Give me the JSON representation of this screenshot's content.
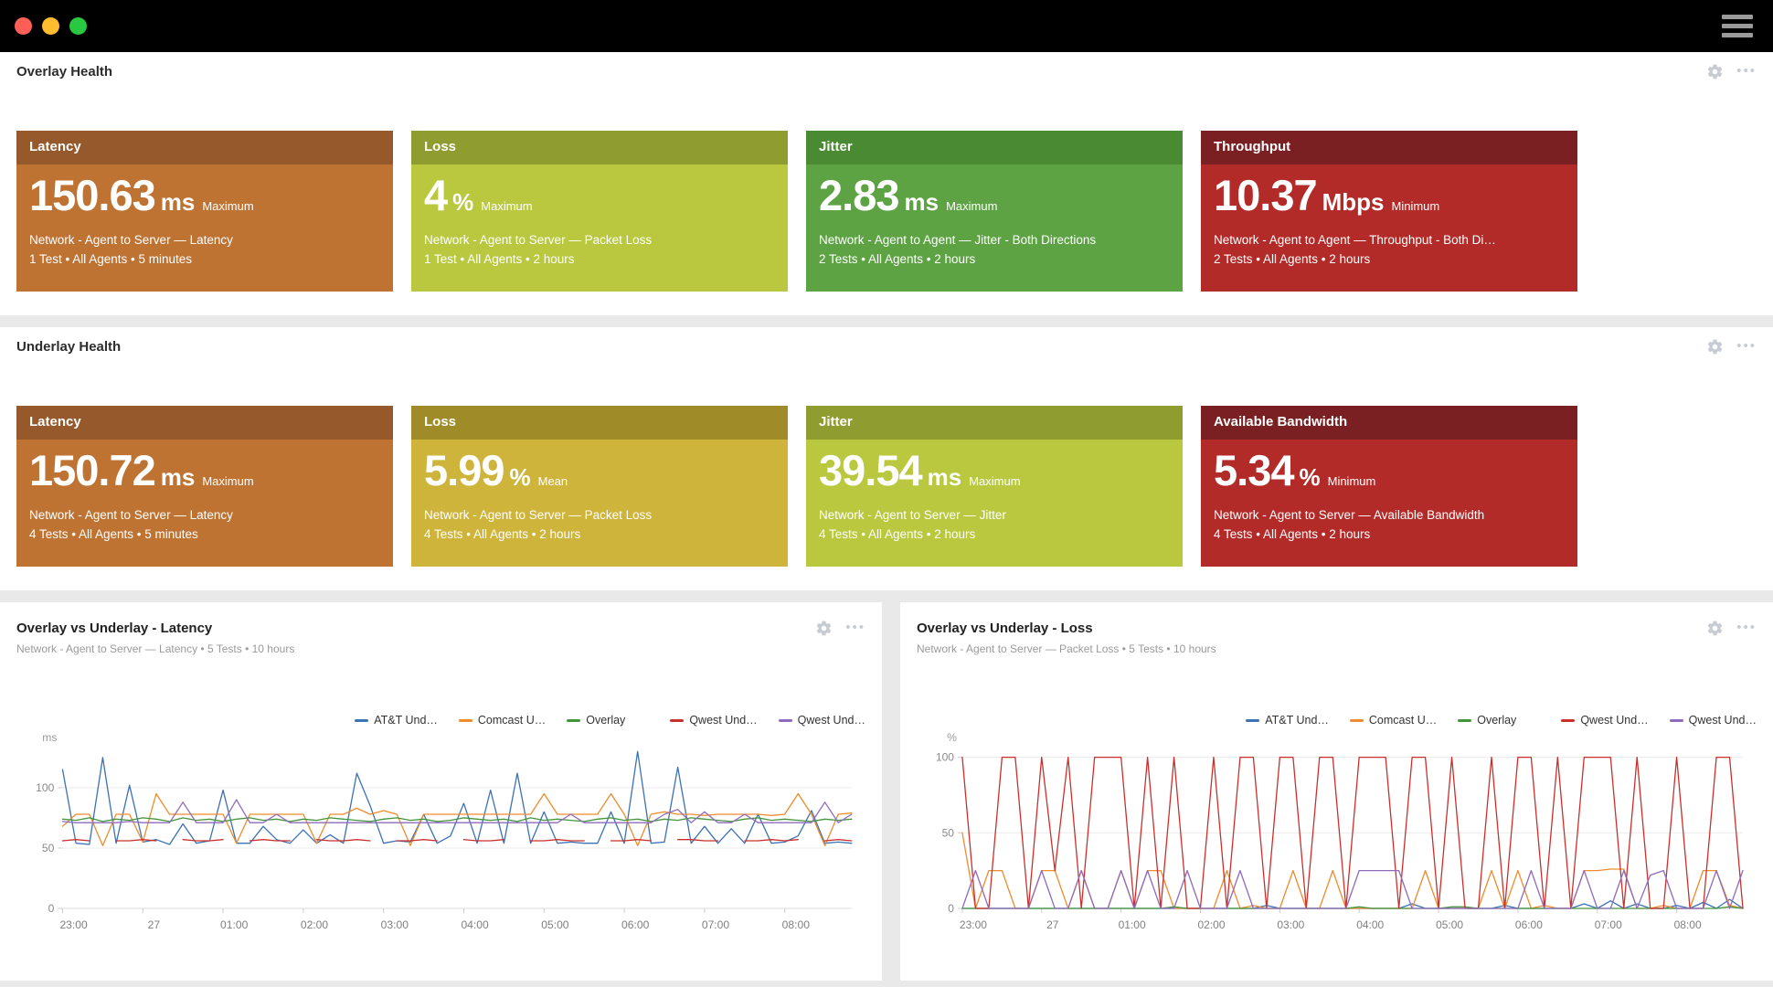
{
  "window": {
    "traffic_lights": [
      "#ff5f57",
      "#febc2e",
      "#28c840"
    ]
  },
  "sections": {
    "overlay": {
      "title": "Overlay Health",
      "cards": [
        {
          "label": "Latency",
          "value": "150.63",
          "unit": "ms",
          "qualifier": "Maximum",
          "line1": "Network - Agent to Server — Latency",
          "line2": "1 Test • All Agents • 5 minutes",
          "header_color": "#96592b",
          "body_color": "#bf7333"
        },
        {
          "label": "Loss",
          "value": "4",
          "unit": "%",
          "qualifier": "Maximum",
          "line1": "Network - Agent to Server — Packet Loss",
          "line2": "1 Test • All Agents • 2 hours",
          "header_color": "#8f9c2f",
          "body_color": "#b9c83f"
        },
        {
          "label": "Jitter",
          "value": "2.83",
          "unit": "ms",
          "qualifier": "Maximum",
          "line1": "Network - Agent to Agent — Jitter - Both Directions",
          "line2": "2 Tests • All Agents • 2 hours",
          "header_color": "#4a8a33",
          "body_color": "#5da344"
        },
        {
          "label": "Throughput",
          "value": "10.37",
          "unit": "Mbps",
          "qualifier": "Minimum",
          "line1": "Network - Agent to Agent — Throughput - Both Di…",
          "line2": "2 Tests • All Agents • 2 hours",
          "header_color": "#7a2023",
          "body_color": "#b32b28"
        }
      ]
    },
    "underlay": {
      "title": "Underlay Health",
      "cards": [
        {
          "label": "Latency",
          "value": "150.72",
          "unit": "ms",
          "qualifier": "Maximum",
          "line1": "Network - Agent to Server — Latency",
          "line2": "4 Tests • All Agents • 5 minutes",
          "header_color": "#96592b",
          "body_color": "#bf7333"
        },
        {
          "label": "Loss",
          "value": "5.99",
          "unit": "%",
          "qualifier": "Mean",
          "line1": "Network - Agent to Server — Packet Loss",
          "line2": "4 Tests • All Agents • 2 hours",
          "header_color": "#9f8c28",
          "body_color": "#cfb43c"
        },
        {
          "label": "Jitter",
          "value": "39.54",
          "unit": "ms",
          "qualifier": "Maximum",
          "line1": "Network - Agent to Server — Jitter",
          "line2": "4 Tests • All Agents • 2 hours",
          "header_color": "#8f9c2f",
          "body_color": "#b9c83f"
        },
        {
          "label": "Available Bandwidth",
          "value": "5.34",
          "unit": "%",
          "qualifier": "Minimum",
          "line1": "Network - Agent to Server — Available Bandwidth",
          "line2": "4 Tests • All Agents • 2 hours",
          "header_color": "#7a2023",
          "body_color": "#b32b28"
        }
      ]
    }
  },
  "chart_data": [
    {
      "type": "line",
      "title": "Overlay vs Underlay - Latency",
      "subtitle": "Network - Agent to Server — Latency • 5 Tests • 10 hours",
      "ylabel": "ms",
      "ylim": [
        0,
        134
      ],
      "yticks": [
        0,
        50,
        100
      ],
      "grid": true,
      "legend_position": "top-right",
      "x_start_label": "23:00",
      "x_interval_minutes": 10,
      "x_total_minutes": 590,
      "x_tick_labels": [
        "23:00",
        "27",
        "01:00",
        "02:00",
        "03:00",
        "04:00",
        "05:00",
        "06:00",
        "07:00",
        "08:00"
      ],
      "series": [
        {
          "name": "AT&T Und…",
          "color": "#3d72b4",
          "values": [
            115,
            54,
            53,
            125,
            54,
            102,
            55,
            57,
            53,
            70,
            54,
            56,
            98,
            54,
            54,
            68,
            57,
            54,
            65,
            54,
            61,
            54,
            112,
            85,
            54,
            56,
            55,
            78,
            54,
            60,
            87,
            54,
            98,
            54,
            112,
            54,
            80,
            54,
            55,
            54,
            54,
            80,
            54,
            130,
            54,
            55,
            117,
            54,
            68,
            54,
            66,
            54,
            78,
            54,
            55,
            60,
            81,
            54,
            55,
            54
          ]
        },
        {
          "name": "Comcast U…",
          "color": "#ef8c2d",
          "values": [
            68,
            78,
            78,
            52,
            78,
            78,
            55,
            95,
            78,
            78,
            78,
            78,
            78,
            54,
            78,
            78,
            78,
            78,
            78,
            54,
            78,
            78,
            83,
            78,
            81,
            78,
            52,
            78,
            78,
            78,
            78,
            78,
            78,
            78,
            78,
            78,
            95,
            78,
            78,
            78,
            78,
            95,
            78,
            52,
            78,
            80,
            78,
            78,
            77,
            78,
            78,
            78,
            78,
            77,
            78,
            95,
            78,
            52,
            78,
            79
          ]
        },
        {
          "name": "Overlay",
          "color": "#43953b",
          "values": [
            74,
            73,
            75,
            72,
            74,
            73,
            75,
            74,
            72,
            75,
            73,
            74,
            72,
            74,
            75,
            73,
            74,
            72,
            74,
            73,
            75,
            74,
            73,
            72,
            74,
            75,
            73,
            74,
            72,
            73,
            75,
            74,
            73,
            74,
            72,
            75,
            73,
            74,
            73,
            72,
            74,
            75,
            73,
            74,
            72,
            74,
            73,
            75,
            74,
            73,
            72,
            74,
            75,
            73,
            74,
            73,
            72,
            74,
            73,
            74
          ]
        },
        {
          "name": "Qwest Und…",
          "color": "#c9302c",
          "values": [
            56,
            57,
            56,
            null,
            56,
            56,
            57,
            56,
            null,
            57,
            56,
            56,
            57,
            null,
            56,
            57,
            56,
            56,
            null,
            57,
            56,
            56,
            57,
            56,
            null,
            56,
            56,
            57,
            56,
            null,
            57,
            56,
            56,
            57,
            null,
            56,
            56,
            57,
            56,
            56,
            null,
            56,
            56,
            57,
            56,
            null,
            57,
            57,
            56,
            56,
            null,
            56,
            56,
            57,
            56,
            57,
            null,
            56,
            57,
            56
          ]
        },
        {
          "name": "Qwest Und…",
          "color": "#8f6bbf",
          "values": [
            72,
            71,
            71,
            71,
            71,
            72,
            71,
            71,
            71,
            88,
            71,
            71,
            71,
            90,
            71,
            71,
            78,
            71,
            71,
            71,
            71,
            71,
            71,
            71,
            71,
            71,
            71,
            71,
            71,
            71,
            71,
            71,
            71,
            71,
            71,
            71,
            71,
            71,
            78,
            71,
            71,
            71,
            71,
            71,
            71,
            78,
            82,
            71,
            80,
            71,
            71,
            78,
            71,
            71,
            71,
            71,
            71,
            88,
            71,
            78
          ]
        }
      ]
    },
    {
      "type": "line",
      "title": "Overlay vs Underlay - Loss",
      "subtitle": "Network - Agent to Server — Packet Loss • 5 Tests • 10 hours",
      "ylabel": "%",
      "ylim": [
        0,
        107
      ],
      "yticks": [
        0,
        50,
        100
      ],
      "grid": true,
      "legend_position": "top-right",
      "x_start_label": "23:00",
      "x_interval_minutes": 10,
      "x_total_minutes": 590,
      "x_tick_labels": [
        "23:00",
        "27",
        "01:00",
        "02:00",
        "03:00",
        "04:00",
        "05:00",
        "06:00",
        "07:00",
        "08:00"
      ],
      "series": [
        {
          "name": "AT&T Und…",
          "color": "#3d72b4",
          "values": [
            0,
            0,
            0,
            0,
            0,
            0,
            0,
            0,
            0,
            0,
            0,
            0,
            0,
            0,
            0,
            0,
            0,
            0,
            0,
            0,
            0,
            0,
            0,
            2,
            0,
            0,
            0,
            0,
            0,
            0,
            0,
            0,
            0,
            0,
            3,
            0,
            0,
            0,
            0,
            0,
            0,
            2,
            0,
            0,
            0,
            0,
            0,
            3,
            0,
            5,
            0,
            3,
            0,
            0,
            2,
            0,
            4,
            0,
            6,
            0
          ]
        },
        {
          "name": "Comcast U…",
          "color": "#ef8c2d",
          "values": [
            50,
            0,
            25,
            25,
            0,
            0,
            25,
            25,
            0,
            25,
            0,
            0,
            25,
            0,
            25,
            25,
            0,
            0,
            0,
            0,
            25,
            0,
            2,
            0,
            0,
            25,
            0,
            0,
            25,
            0,
            0,
            0,
            0,
            0,
            0,
            25,
            0,
            0,
            0,
            0,
            25,
            0,
            25,
            0,
            2,
            0,
            0,
            25,
            25,
            26,
            26,
            0,
            0,
            2,
            0,
            0,
            25,
            25,
            2,
            0
          ]
        },
        {
          "name": "Overlay",
          "color": "#43953b",
          "values": [
            0,
            0,
            0,
            0,
            0,
            0,
            0,
            0,
            0,
            0,
            0,
            0,
            0,
            0,
            0,
            0,
            1,
            0,
            0,
            0,
            0,
            0,
            0,
            0,
            0,
            0,
            0,
            0,
            0,
            0,
            1,
            0,
            0,
            0,
            0,
            0,
            0,
            1,
            1,
            0,
            0,
            0,
            0,
            0,
            0,
            0,
            0,
            0,
            0,
            0,
            0,
            0,
            0,
            0,
            0,
            0,
            0,
            0,
            1,
            0
          ]
        },
        {
          "name": "Qwest Und…",
          "color": "#c9302c",
          "values": [
            100,
            0,
            0,
            100,
            100,
            0,
            100,
            25,
            100,
            0,
            100,
            100,
            100,
            0,
            100,
            0,
            100,
            0,
            0,
            100,
            0,
            100,
            100,
            0,
            100,
            100,
            0,
            100,
            100,
            0,
            100,
            100,
            100,
            0,
            100,
            100,
            0,
            100,
            0,
            0,
            100,
            0,
            100,
            100,
            0,
            100,
            0,
            100,
            100,
            100,
            0,
            100,
            0,
            0,
            100,
            0,
            0,
            100,
            100,
            0
          ]
        },
        {
          "name": "Qwest Und…",
          "color": "#8f6bbf",
          "values": [
            0,
            25,
            0,
            0,
            0,
            0,
            25,
            0,
            0,
            25,
            0,
            0,
            25,
            0,
            25,
            0,
            0,
            25,
            0,
            0,
            0,
            25,
            0,
            0,
            0,
            0,
            0,
            0,
            0,
            0,
            25,
            25,
            25,
            25,
            0,
            0,
            0,
            0,
            0,
            0,
            0,
            0,
            0,
            25,
            0,
            0,
            0,
            25,
            0,
            0,
            25,
            0,
            22,
            25,
            0,
            0,
            0,
            25,
            0,
            25
          ]
        }
      ]
    }
  ]
}
